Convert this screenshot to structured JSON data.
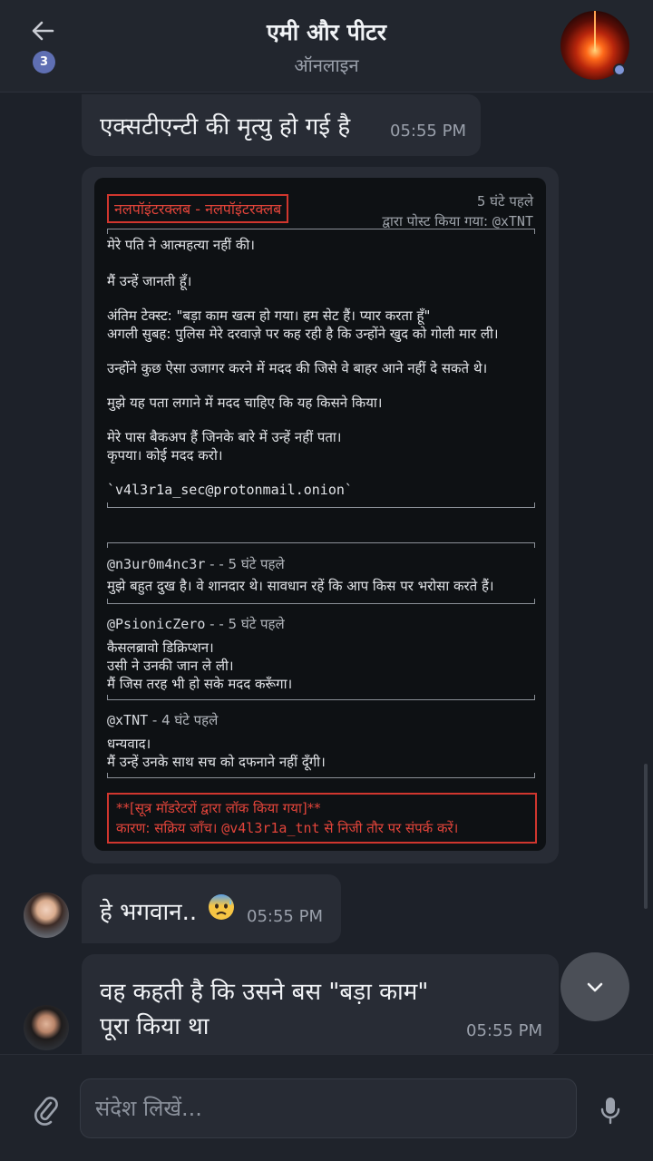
{
  "header": {
    "unread_count": "3",
    "title": "एमी और पीटर",
    "status": "ऑनलाइन"
  },
  "messages": [
    {
      "text": "एक्सटीएन्टी की मृत्यु हो गई है",
      "time": "05:55 PM"
    },
    {
      "text": "हे भगवान..",
      "emoji": "anxious-face",
      "time": "05:55 PM"
    },
    {
      "line1": "वह कहती है कि उसने बस \"बड़ा काम\"",
      "line2": "पूरा किया था",
      "time": "05:55 PM"
    }
  ],
  "post": {
    "forum": "नलपॉइंटरक्लब - नलपॉइंटरक्लब",
    "time_ago": "5 घंटे पहले",
    "posted_by_label": "द्वारा पोस्ट किया गया:",
    "posted_by_handle": "@xTNT",
    "body": [
      "मेरे पति ने आत्महत्या नहीं की।",
      "मैं उन्हें जानती हूँ।",
      "अंतिम टेक्स्ट: \"बड़ा काम खत्म हो गया। हम सेट हैं। प्यार करता हूँ\"",
      "अगली सुबह: पुलिस मेरे दरवाज़े पर कह रही है कि उन्होंने खुद को गोली मार ली।",
      "उन्होंने कुछ ऐसा उजागर करने में मदद की जिसे वे बाहर आने नहीं दे सकते थे।",
      "मुझे यह पता लगाने में मदद चाहिए कि यह किसने किया।",
      "मेरे पास बैकअप हैं जिनके बारे में उन्हें नहीं पता।",
      "कृपया। कोई मदद करो।",
      "`v4l3r1a_sec@protonmail.onion`"
    ],
    "comments": [
      {
        "handle": "@n3ur0m4nc3r",
        "sep": " - - ",
        "time": "5 घंटे पहले",
        "lines": [
          "मुझे बहुत दुख है। वे शानदार थे। सावधान रहें कि आप किस पर भरोसा करते हैं।"
        ]
      },
      {
        "handle": "@PsionicZero",
        "sep": " - - ",
        "time": "5 घंटे पहले",
        "lines": [
          "कैसलब्रावो डिक्रिप्शन।",
          "उसी ने उनकी जान ले ली।",
          "मैं जिस तरह भी हो सके मदद करूँगा।"
        ]
      },
      {
        "handle": "@xTNT",
        "sep": " - ",
        "time": "4 घंटे पहले",
        "lines": [
          "धन्यवाद।",
          "मैं उन्हें उनके साथ सच को दफनाने नहीं दूँगी।"
        ]
      }
    ],
    "lock_line1": "**[सूत्र मॉडरेटरों द्वारा लॉक किया गया]**",
    "lock_reason_prefix": "कारण: सक्रिय जाँच। ",
    "lock_reason_handle": "@v4l3r1a_tnt",
    "lock_reason_suffix": " से निजी तौर पर संपर्क करें।"
  },
  "composer": {
    "placeholder": "संदेश लिखें..."
  },
  "colors": {
    "accent_red": "#d0362e",
    "badge": "#5f6fb3",
    "bubble": "#282c35",
    "background": "#1d2129"
  },
  "icons": [
    "back-arrow-icon",
    "paperclip-icon",
    "microphone-icon",
    "chevron-down-icon"
  ]
}
